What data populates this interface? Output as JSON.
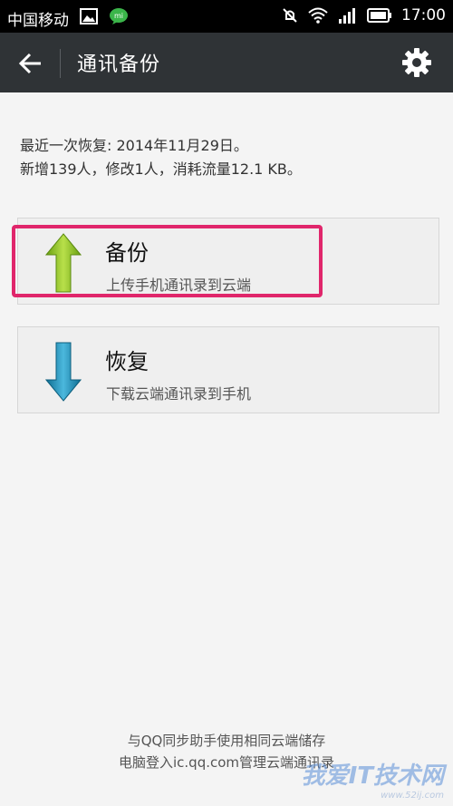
{
  "status_bar": {
    "carrier": "中国移动",
    "time": "17:00"
  },
  "app_bar": {
    "title": "通讯备份"
  },
  "info": {
    "line1": "最近一次恢复: 2014年11月29日。",
    "line2": "新增139人，修改1人，消耗流量12.1 KB。"
  },
  "cards": [
    {
      "title": "备份",
      "subtitle": "上传手机通讯录到云端",
      "icon": "arrow-up-icon",
      "color": "#8dc21f"
    },
    {
      "title": "恢复",
      "subtitle": "下载云端通讯录到手机",
      "icon": "arrow-down-icon",
      "color": "#1a8cb6"
    }
  ],
  "footer": {
    "line1": "与QQ同步助手使用相同云端储存",
    "line2": "电脑登入ic.qq.com管理云端通讯录"
  },
  "watermark": {
    "text": "我爱IT技术网",
    "url": "www.52ij.com"
  },
  "colors": {
    "highlight": "#e0266b",
    "app_bar": "#2f3336"
  }
}
